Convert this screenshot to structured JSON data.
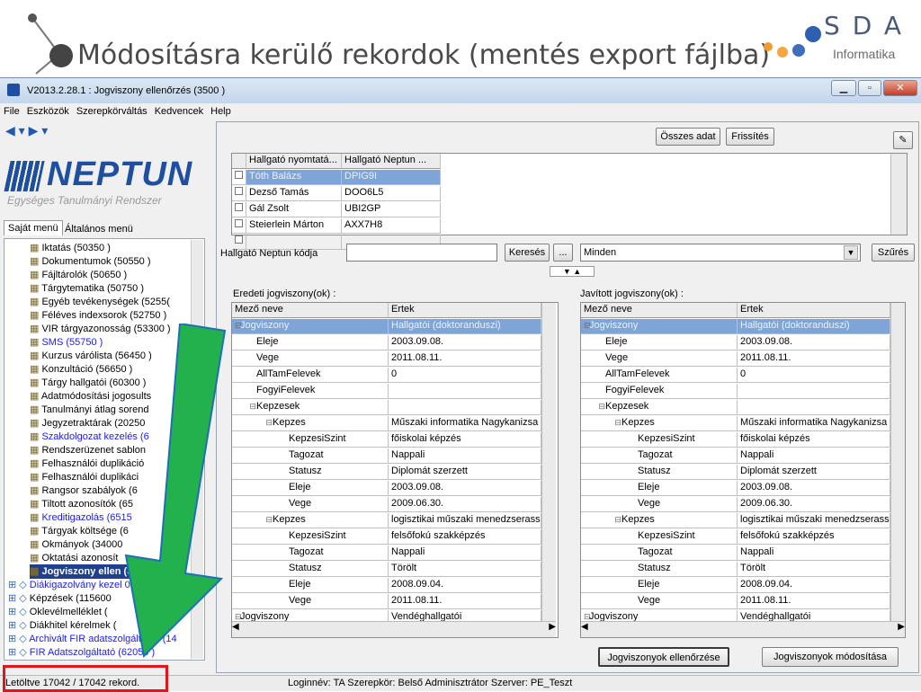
{
  "slide": {
    "title": "Módosításra kerülő rekordok (mentés export fájlba)"
  },
  "logo": {
    "letters": "SDA",
    "sub": "Informatika"
  },
  "window": {
    "title": "V2013.2.28.1 : Jogviszony ellenőrzés (3500 )"
  },
  "menu": [
    "File",
    "Eszközök",
    "Szerepkörváltás",
    "Kedvencek",
    "Help"
  ],
  "neptun": {
    "name": "NEPTUN",
    "tagline": "Egységes Tanulmányi Rendszer"
  },
  "tabs": [
    "Saját menü",
    "Általános menü"
  ],
  "tree": [
    {
      "label": "Iktatás (50350 )",
      "color": "#000"
    },
    {
      "label": "Dokumentumok (50550 )",
      "color": "#000"
    },
    {
      "label": "Fájltárolók (50650 )",
      "color": "#000"
    },
    {
      "label": "Tárgytematika (50750 )",
      "color": "#000"
    },
    {
      "label": "Egyéb tevékenységek (5255(",
      "color": "#000"
    },
    {
      "label": "Féléves indexsorok (52750 )",
      "color": "#000"
    },
    {
      "label": "VIR tárgyazonosság (53300 )",
      "color": "#000"
    },
    {
      "label": "SMS (55750 )",
      "color": "#1a1aff"
    },
    {
      "label": "Kurzus várólista (56450 )",
      "color": "#000"
    },
    {
      "label": "Konzultáció (56650 )",
      "color": "#000"
    },
    {
      "label": "Tárgy hallgatói (60300 )",
      "color": "#000"
    },
    {
      "label": "Adatmódosítási jogosults",
      "color": "#000"
    },
    {
      "label": "Tanulmányi átlag sorend",
      "color": "#000"
    },
    {
      "label": "Jegyzetraktárak (20250",
      "color": "#000"
    },
    {
      "label": "Szakdolgozat kezelés (6",
      "color": "#1a1aff"
    },
    {
      "label": "Rendszerüzenet sablon",
      "color": "#000"
    },
    {
      "label": "Felhasználói duplikáció",
      "color": "#000"
    },
    {
      "label": "Felhasználói duplikáci",
      "color": "#000"
    },
    {
      "label": "Rangsor szabályok (6",
      "color": "#000"
    },
    {
      "label": "Tiltott azonosítók (65",
      "color": "#000"
    },
    {
      "label": "Kreditigazolás (6515",
      "color": "#1a1aff"
    },
    {
      "label": "Tárgyak költsége (6",
      "color": "#000"
    },
    {
      "label": "Okmányok (34000",
      "color": "#000"
    },
    {
      "label": "Oktatási azonosít",
      "color": "#000"
    },
    {
      "label": "Jogviszony ellen (3",
      "color": "#fff"
    },
    {
      "label": "Diákigazolvány kezel 0 )",
      "color": "#1a1aff"
    },
    {
      "label": "Képzések (115600",
      "color": "#000"
    },
    {
      "label": "Oklevélmelléklet (",
      "color": "#000"
    },
    {
      "label": "Diákhitel kérelmek (",
      "color": "#000"
    },
    {
      "label": "Archivált FIR adatszolgáltatás (14",
      "color": "#1a1aff"
    },
    {
      "label": "FIR Adatszolgáltató (62050 )",
      "color": "#1a1aff"
    }
  ],
  "toolbar": {
    "osszes": "Összes adat",
    "frissites": "Frissítés"
  },
  "students": {
    "headers": [
      "Hallgató nyomtatá...",
      "Hallgató Neptun ..."
    ],
    "rows": [
      [
        "Tóth Balázs",
        "DPIG9I"
      ],
      [
        "Dezső Tamás",
        "DOO6L5"
      ],
      [
        "Gál Zsolt",
        "UBI2GP"
      ],
      [
        "Steierlein Márton",
        "AXX7H8"
      ],
      [
        "",
        ""
      ]
    ]
  },
  "search": {
    "label": "Hallgató Neptun kódja",
    "value": "",
    "search_btn": "Keresés",
    "more_btn": "...",
    "filter_value": "Minden",
    "filter_btn": "Szűrés"
  },
  "left_grid": {
    "caption": "Eredeti jogviszony(ok) :"
  },
  "right_grid": {
    "caption": "Javított jogviszony(ok) :"
  },
  "grid_headers": [
    "Mező neve",
    "Ertek"
  ],
  "grid_rows": [
    {
      "name": "Jogviszony",
      "value": "Hallgatói (doktoranduszi)",
      "indent": 0,
      "sel": true
    },
    {
      "name": "Eleje",
      "value": "2003.09.08.",
      "indent": 1
    },
    {
      "name": "Vege",
      "value": "2011.08.11.",
      "indent": 1
    },
    {
      "name": "AllTamFelevek",
      "value": "0",
      "indent": 1
    },
    {
      "name": "FogyiFelevek",
      "value": "",
      "indent": 1
    },
    {
      "name": "Kepzesek",
      "value": "",
      "indent": 1
    },
    {
      "name": "Kepzes",
      "value": "Műszaki informatika Nagykanizsa (",
      "indent": 2
    },
    {
      "name": "KepzesiSzint",
      "value": "főiskolai képzés",
      "indent": 3
    },
    {
      "name": "Tagozat",
      "value": "Nappali",
      "indent": 3
    },
    {
      "name": "Statusz",
      "value": "Diplomát szerzett",
      "indent": 3
    },
    {
      "name": "Eleje",
      "value": "2003.09.08.",
      "indent": 3
    },
    {
      "name": "Vege",
      "value": "2009.06.30.",
      "indent": 3
    },
    {
      "name": "Kepzes",
      "value": "logisztikai műszaki menedzserassz",
      "indent": 2
    },
    {
      "name": "KepzesiSzint",
      "value": "felsőfokú szakképzés",
      "indent": 3
    },
    {
      "name": "Tagozat",
      "value": "Nappali",
      "indent": 3
    },
    {
      "name": "Statusz",
      "value": "Törölt",
      "indent": 3
    },
    {
      "name": "Eleje",
      "value": "2008.09.04.",
      "indent": 3
    },
    {
      "name": "Vege",
      "value": "2011.08.11.",
      "indent": 3
    },
    {
      "name": "Jogviszony",
      "value": "Vendéghallgatói",
      "indent": 0
    }
  ],
  "buttons": {
    "ellenorzes": "Jogviszonyok ellenőrzése",
    "modositasa": "Jogviszonyok módosítása"
  },
  "status": {
    "loaded": "Letöltve 17042 / 17042 rekord.",
    "login": "Loginnév: TA  Szerepkör: Belső Adminisztrátor  Szerver: PE_Teszt"
  },
  "colors": {
    "selection": "#7ea4d8",
    "arrow": "#22b14c",
    "highlight": "#e0161c"
  }
}
